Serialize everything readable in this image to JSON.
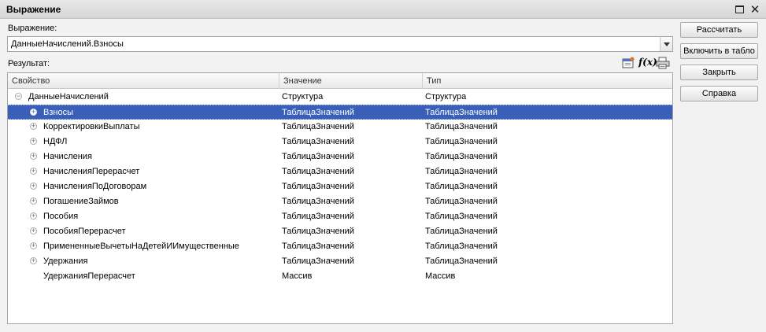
{
  "window": {
    "title": "Выражение"
  },
  "expression": {
    "label": "Выражение:",
    "value": "ДанныеНачислений.Взносы"
  },
  "result": {
    "label": "Результат:"
  },
  "toolbar": {
    "icons": [
      "window-icon",
      "function-icon",
      "print-icon"
    ],
    "fx_glyph": "f(x)"
  },
  "table": {
    "columns": [
      "Свойство",
      "Значение",
      "Тип"
    ],
    "rows": [
      {
        "name": "ДанныеНачислений",
        "value": "Структура",
        "type": "Структура",
        "level": 0,
        "toggle": "−",
        "selected": false
      },
      {
        "name": "Взносы",
        "value": "ТаблицаЗначений",
        "type": "ТаблицаЗначений",
        "level": 1,
        "toggle": "+",
        "selected": true
      },
      {
        "name": "КорректировкиВыплаты",
        "value": "ТаблицаЗначений",
        "type": "ТаблицаЗначений",
        "level": 1,
        "toggle": "+",
        "selected": false
      },
      {
        "name": "НДФЛ",
        "value": "ТаблицаЗначений",
        "type": "ТаблицаЗначений",
        "level": 1,
        "toggle": "+",
        "selected": false
      },
      {
        "name": "Начисления",
        "value": "ТаблицаЗначений",
        "type": "ТаблицаЗначений",
        "level": 1,
        "toggle": "+",
        "selected": false
      },
      {
        "name": "НачисленияПерерасчет",
        "value": "ТаблицаЗначений",
        "type": "ТаблицаЗначений",
        "level": 1,
        "toggle": "+",
        "selected": false
      },
      {
        "name": "НачисленияПоДоговорам",
        "value": "ТаблицаЗначений",
        "type": "ТаблицаЗначений",
        "level": 1,
        "toggle": "+",
        "selected": false
      },
      {
        "name": "ПогашениеЗаймов",
        "value": "ТаблицаЗначений",
        "type": "ТаблицаЗначений",
        "level": 1,
        "toggle": "+",
        "selected": false
      },
      {
        "name": "Пособия",
        "value": "ТаблицаЗначений",
        "type": "ТаблицаЗначений",
        "level": 1,
        "toggle": "+",
        "selected": false
      },
      {
        "name": "ПособияПерерасчет",
        "value": "ТаблицаЗначений",
        "type": "ТаблицаЗначений",
        "level": 1,
        "toggle": "+",
        "selected": false
      },
      {
        "name": "ПримененныеВычетыНаДетейИИмущественные",
        "value": "ТаблицаЗначений",
        "type": "ТаблицаЗначений",
        "level": 1,
        "toggle": "+",
        "selected": false
      },
      {
        "name": "Удержания",
        "value": "ТаблицаЗначений",
        "type": "ТаблицаЗначений",
        "level": 1,
        "toggle": "+",
        "selected": false
      },
      {
        "name": "УдержанияПерерасчет",
        "value": "Массив",
        "type": "Массив",
        "level": 1,
        "toggle": "",
        "selected": false
      }
    ]
  },
  "buttons": {
    "calculate": "Рассчитать",
    "add_to_board": "Включить в табло",
    "close": "Закрыть",
    "help": "Справка"
  },
  "colors": {
    "selection": "#3a5fb8",
    "titlebar": "#dcdcdc"
  }
}
